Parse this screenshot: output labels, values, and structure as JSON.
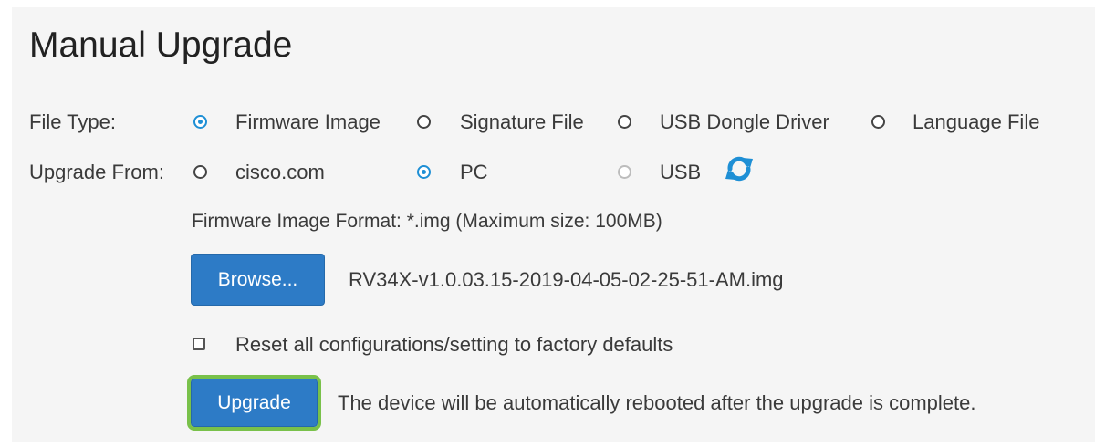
{
  "title": "Manual Upgrade",
  "file_type": {
    "label": "File Type:",
    "options": [
      {
        "label": "Firmware Image",
        "checked": true
      },
      {
        "label": "Signature File",
        "checked": false
      },
      {
        "label": "USB Dongle Driver",
        "checked": false
      },
      {
        "label": "Language File",
        "checked": false
      }
    ]
  },
  "upgrade_from": {
    "label": "Upgrade From:",
    "options": [
      {
        "label": "cisco.com",
        "checked": false
      },
      {
        "label": "PC",
        "checked": true
      },
      {
        "label": "USB",
        "checked": false,
        "disabled": true
      }
    ],
    "refresh_icon": "refresh-icon",
    "refresh_color": "#1e8fd5"
  },
  "format_note": "Firmware Image Format: *.img (Maximum size: 100MB)",
  "browse": {
    "button_label": "Browse...",
    "selected_file": "RV34X-v1.0.03.15-2019-04-05-02-25-51-AM.img"
  },
  "reset": {
    "label": "Reset all configurations/setting to factory defaults",
    "checked": false
  },
  "upgrade": {
    "button_label": "Upgrade",
    "note": "The device will be automatically rebooted after the upgrade is complete.",
    "highlight_color": "#79c14a"
  },
  "colors": {
    "accent": "#1e8fd5",
    "button": "#2d7bc6",
    "panel": "#f5f5f5"
  }
}
